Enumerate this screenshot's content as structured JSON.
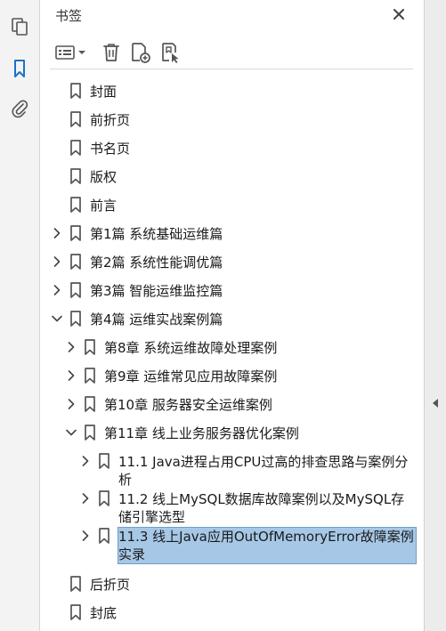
{
  "panel": {
    "title": "书签"
  },
  "rail": {
    "items": [
      {
        "icon": "pages-icon",
        "active": false
      },
      {
        "icon": "bookmark-icon",
        "active": true
      },
      {
        "icon": "attachment-icon",
        "active": false
      }
    ]
  },
  "toolbar": {
    "buttons": [
      {
        "icon": "options-menu-icon"
      },
      {
        "icon": "delete-icon"
      },
      {
        "icon": "new-bookmark-icon"
      },
      {
        "icon": "bookmark-from-selection-icon"
      }
    ]
  },
  "colors": {
    "accent": "#1a73c9",
    "selection": "#a6c8e6",
    "icon": "#555555"
  },
  "bookmarks": [
    {
      "label": "封面",
      "level": 0,
      "expandable": false
    },
    {
      "label": "前折页",
      "level": 0,
      "expandable": false
    },
    {
      "label": "书名页",
      "level": 0,
      "expandable": false
    },
    {
      "label": "版权",
      "level": 0,
      "expandable": false
    },
    {
      "label": "前言",
      "level": 0,
      "expandable": false
    },
    {
      "label": "第1篇 系统基础运维篇",
      "level": 0,
      "expandable": true,
      "expanded": false
    },
    {
      "label": "第2篇 系统性能调优篇",
      "level": 0,
      "expandable": true,
      "expanded": false
    },
    {
      "label": "第3篇 智能运维监控篇",
      "level": 0,
      "expandable": true,
      "expanded": false
    },
    {
      "label": "第4篇 运维实战案例篇",
      "level": 0,
      "expandable": true,
      "expanded": true
    },
    {
      "label": "第8章 系统运维故障处理案例",
      "level": 1,
      "expandable": true,
      "expanded": false
    },
    {
      "label": "第9章 运维常见应用故障案例",
      "level": 1,
      "expandable": true,
      "expanded": false
    },
    {
      "label": "第10章 服务器安全运维案例",
      "level": 1,
      "expandable": true,
      "expanded": false
    },
    {
      "label": "第11章 线上业务服务器优化案例",
      "level": 1,
      "expandable": true,
      "expanded": true
    },
    {
      "label": "11.1 Java进程占用CPU过高的排查思路与案例分析",
      "level": 2,
      "expandable": true,
      "expanded": false
    },
    {
      "label": "11.2 线上MySQL数据库故障案例以及MySQL存储引擎选型",
      "level": 2,
      "expandable": true,
      "expanded": false
    },
    {
      "label": "11.3 线上Java应用OutOfMemoryError故障案例实录",
      "level": 2,
      "expandable": true,
      "expanded": false,
      "selected": true
    },
    {
      "label": "后折页",
      "level": 0,
      "expandable": false
    },
    {
      "label": "封底",
      "level": 0,
      "expandable": false
    }
  ]
}
